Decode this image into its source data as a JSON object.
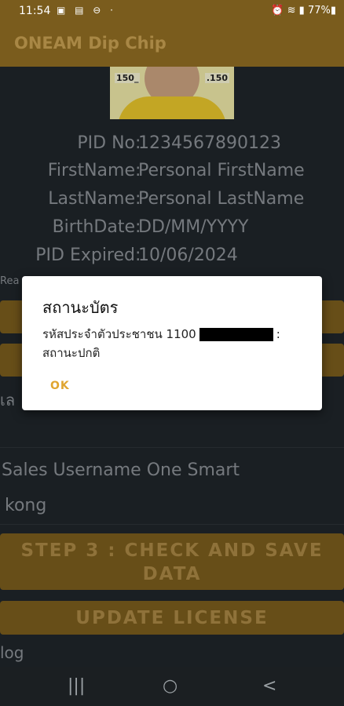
{
  "status_bar": {
    "time": "11:54",
    "left_icons": "▣ ▤ ⊖ ·",
    "battery": "77%",
    "right_icons": "⏰ ≋ ▮ 77%▮"
  },
  "app_bar": {
    "title": "ONEAM Dip Chip"
  },
  "photo": {
    "tag_left": "150_",
    "tag_right": ".150"
  },
  "info": [
    {
      "label": "PID No",
      "value": "1234567890123"
    },
    {
      "label": "FirstName",
      "value": "Personal FirstName"
    },
    {
      "label": "LastName",
      "value": "Personal LastName"
    },
    {
      "label": "BirthDate",
      "value": "DD/MM/YYYY"
    },
    {
      "label": "PID Expired",
      "value": "10/06/2024"
    }
  ],
  "reader_label": "Rea",
  "partial_text": "เล",
  "sales": {
    "label": "Sales Username One Smart",
    "value": "kong"
  },
  "buttons": {
    "step3_line1": "STEP 3 : CHECK AND SAVE",
    "step3_line2": "DATA",
    "update_license": "UPDATE LICENSE"
  },
  "log_label": "log",
  "navbar": {
    "recents": "|||",
    "home": "○",
    "back": "<"
  },
  "dialog": {
    "title": "สถานะบัตร",
    "message_prefix": "รหัสประจำตัวประชาชน 1100",
    "message_suffix": ":",
    "status": "สถานะปกติ",
    "ok_label": "OK"
  },
  "colors": {
    "gold": "#7a5c1d",
    "gold_text": "#a88745",
    "background": "#1f252a",
    "ok_accent": "#e0a530"
  }
}
